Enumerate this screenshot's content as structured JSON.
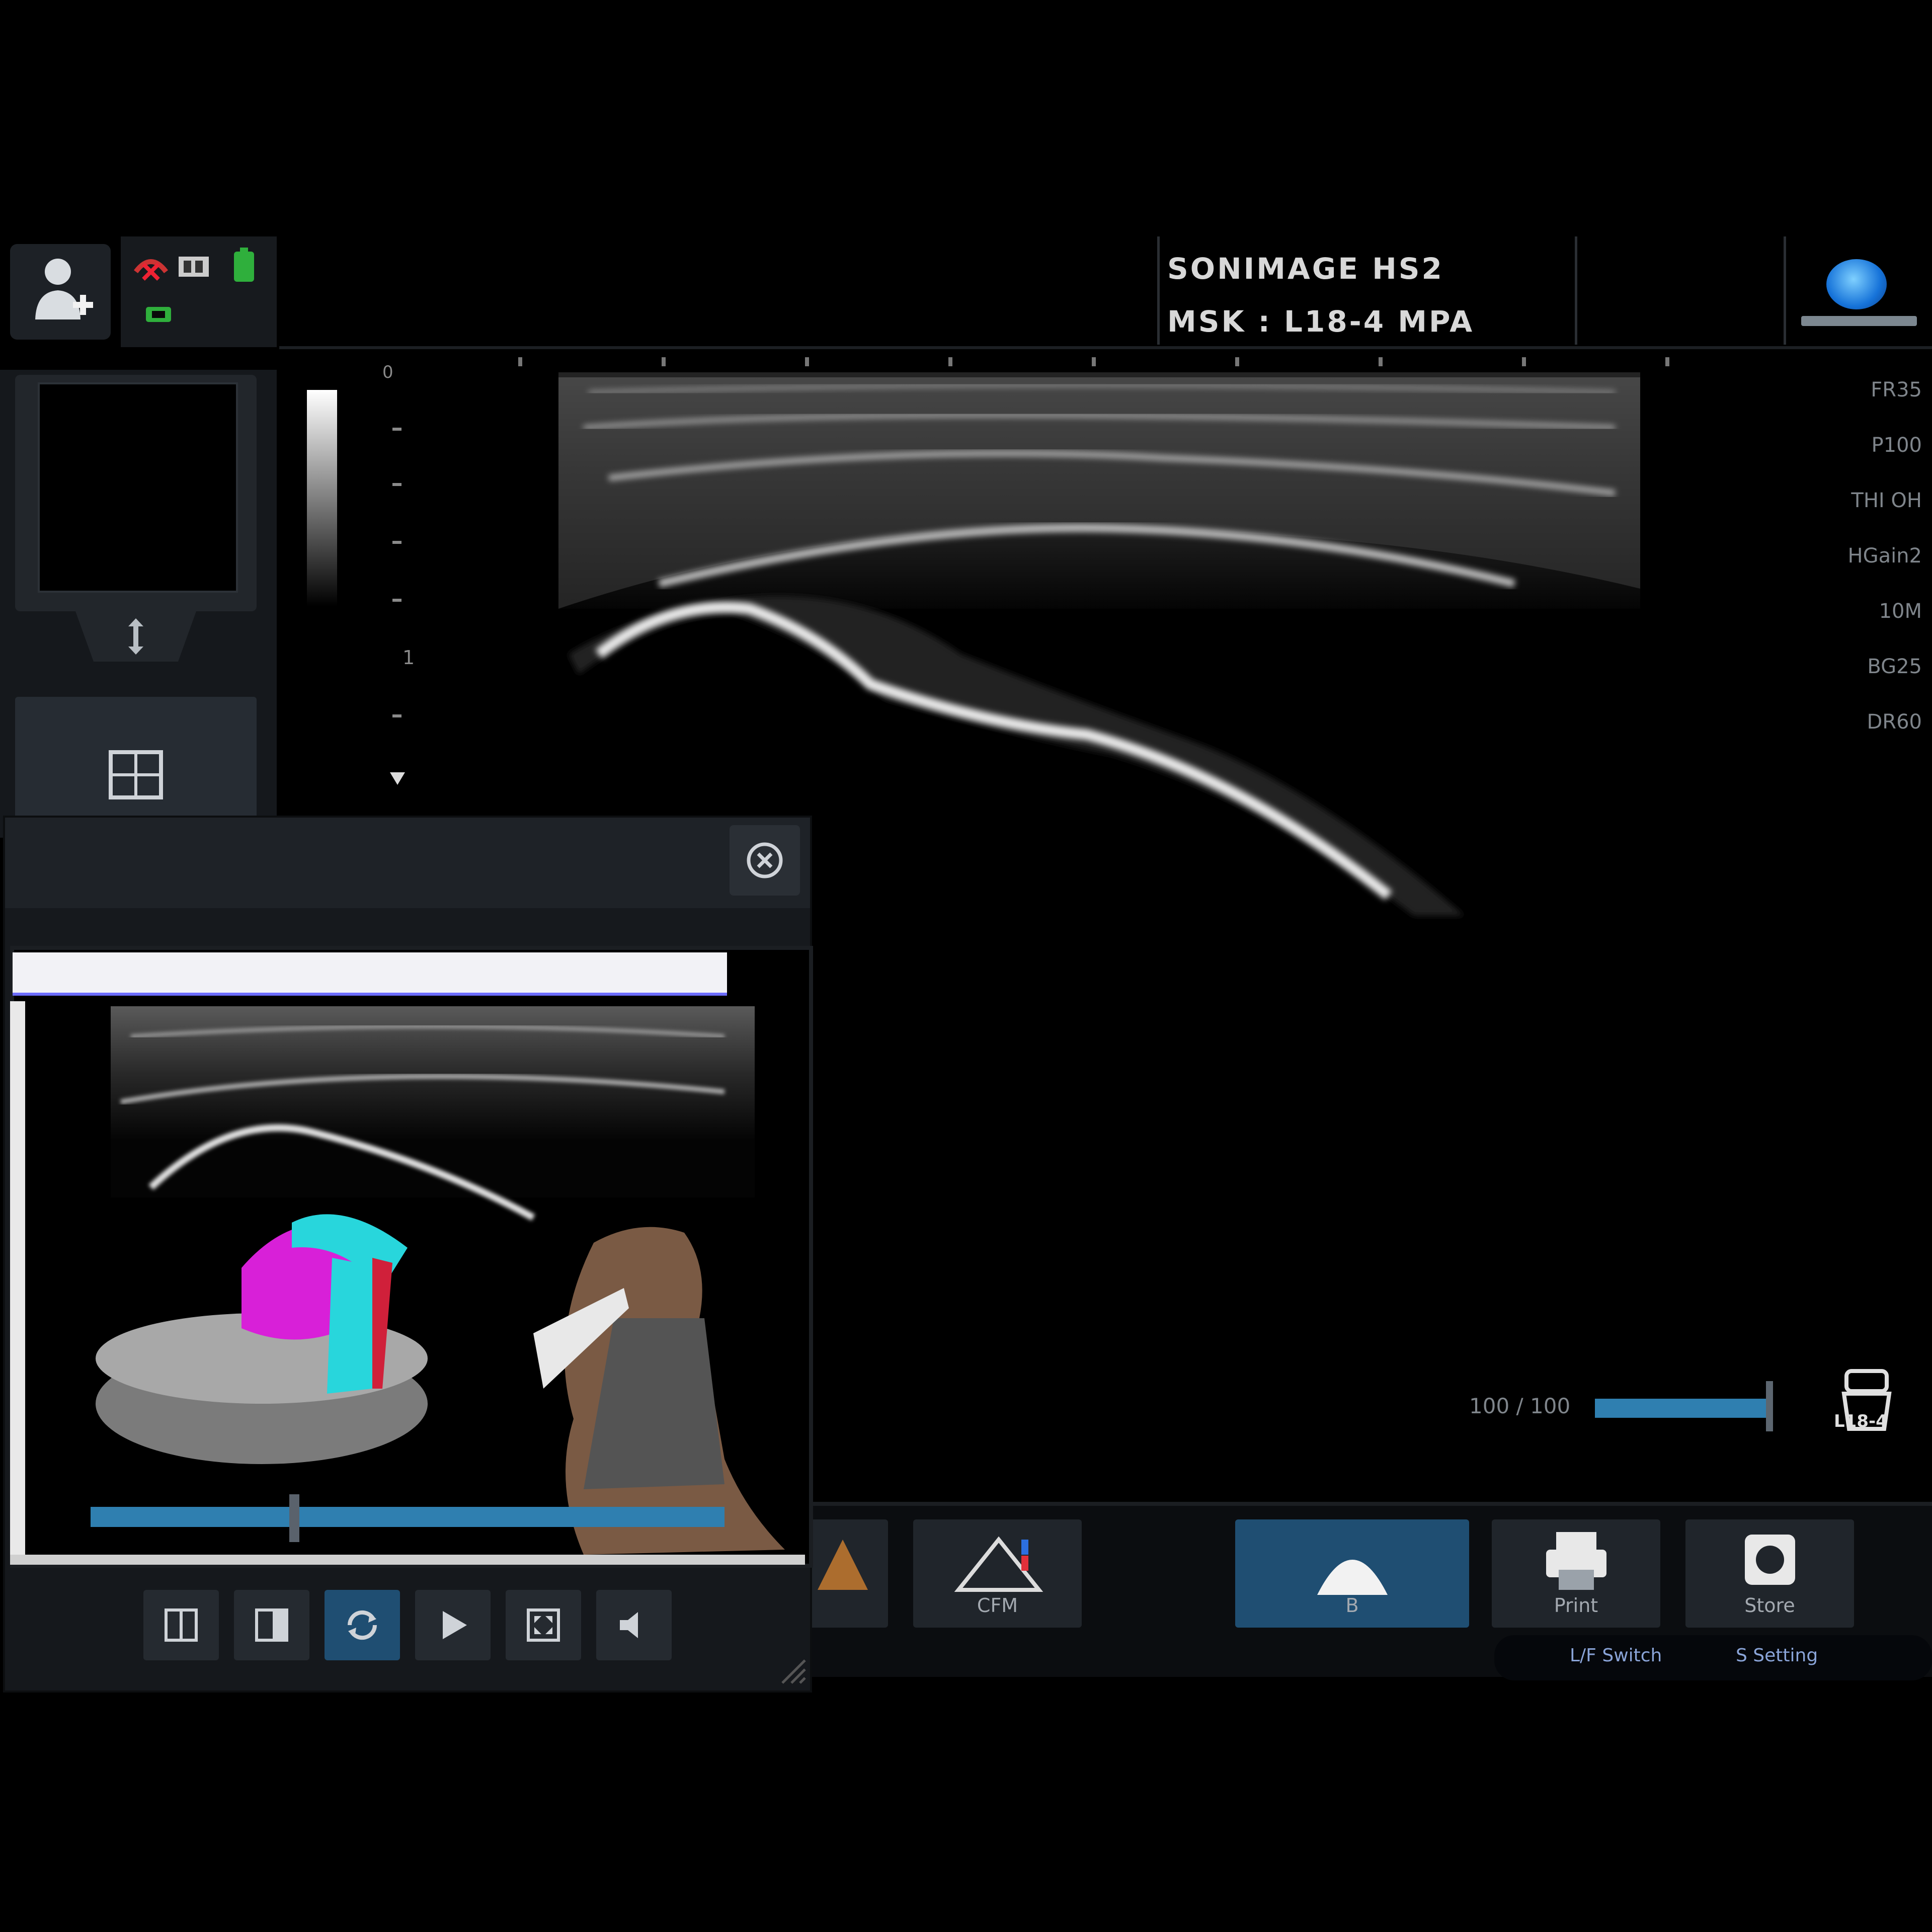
{
  "header": {
    "system_name": "SONIMAGE HS2",
    "preset": "MSK : L18-4 MPA"
  },
  "params": [
    "FR35",
    "P100",
    "THI OH",
    "HGain2",
    "10M",
    "BG25",
    "DR60"
  ],
  "depth_scale": [
    "0",
    "1"
  ],
  "depth_slider": {
    "label": "100 / 100",
    "value_fraction": 1.0
  },
  "probe": {
    "label": "L18-4"
  },
  "toolbar": {
    "buttons": [
      {
        "label": "CFM",
        "icon": "cfm-icon"
      },
      {
        "label": "B",
        "icon": "b-mode-icon"
      },
      {
        "label": "Print",
        "icon": "print-icon"
      },
      {
        "label": "Store",
        "icon": "store-icon"
      }
    ]
  },
  "switch_bar": {
    "left_label": "L/F Switch",
    "right_label": "S Setting"
  },
  "floating_window": {
    "playback_fraction": 0.32,
    "controls": [
      "layout-single-icon",
      "layout-split-icon",
      "loop-icon",
      "play-icon",
      "fullscreen-icon",
      "volume-icon"
    ]
  },
  "colors": {
    "accent": "#2f7fb0",
    "active_button": "#1f4e72",
    "anatomy_magenta": "#d820d8",
    "anatomy_cyan": "#28d6dc",
    "anatomy_red": "#d0203a"
  }
}
